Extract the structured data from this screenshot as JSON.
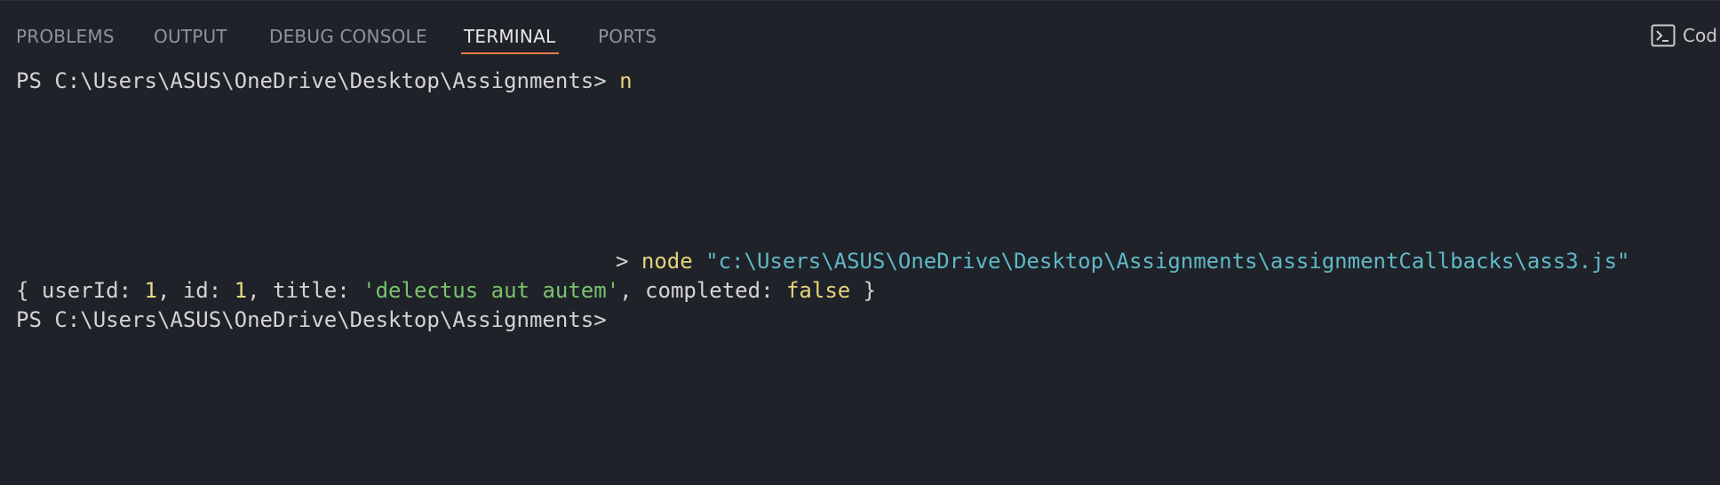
{
  "tabs": [
    {
      "label": "PROBLEMS",
      "active": false
    },
    {
      "label": "OUTPUT",
      "active": false
    },
    {
      "label": "DEBUG CONSOLE",
      "active": false
    },
    {
      "label": "TERMINAL",
      "active": true
    },
    {
      "label": "PORTS",
      "active": false
    }
  ],
  "terminal_launcher": {
    "icon": "terminal-icon",
    "label": "Cod"
  },
  "terminal": {
    "line1": {
      "prompt": "PS C:\\Users\\ASUS\\OneDrive\\Desktop\\Assignments> ",
      "typed": "n"
    },
    "line2": {
      "arrow": "> ",
      "cmd": "node",
      "space": " ",
      "arg": "\"c:\\Users\\ASUS\\OneDrive\\Desktop\\Assignments\\assignmentCallbacks\\ass3.js\""
    },
    "line3": {
      "p1": "{ userId: ",
      "v1": "1",
      "p2": ", id: ",
      "v2": "1",
      "p3": ", title: ",
      "v3": "'delectus aut autem'",
      "p4": ", completed: ",
      "v4": "false",
      "p5": " }"
    },
    "line4": {
      "prompt": "PS C:\\Users\\ASUS\\OneDrive\\Desktop\\Assignments>"
    }
  },
  "colors": {
    "background": "#1f2228",
    "active_tab_underline": "#f07b4d",
    "command": "#e5d37a",
    "path_arg": "#5fb8c8",
    "string": "#79c26d",
    "number": "#e6d987"
  }
}
